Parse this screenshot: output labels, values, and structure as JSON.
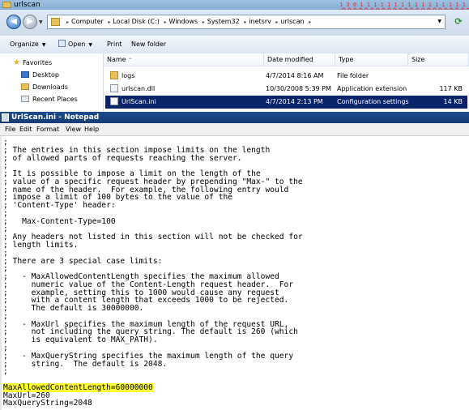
{
  "explorer": {
    "title": "urlscan",
    "annotation_text": "1 3 0 1 1 1 1 1 1 1 1 1 1 1 1 1 1 1 1 1 1",
    "breadcrumbs": [
      "Computer",
      "Local Disk (C:)",
      "Windows",
      "System32",
      "inetsrv",
      "urlscan"
    ],
    "toolbar": {
      "organize": "Organize",
      "open": "Open",
      "print": "Print",
      "new_folder": "New folder"
    },
    "nav": [
      {
        "label": "Favorites",
        "icon": "star-icon"
      },
      {
        "label": "Desktop",
        "icon": "desktop-icon"
      },
      {
        "label": "Downloads",
        "icon": "downloads-icon"
      },
      {
        "label": "Recent Places",
        "icon": "recent-places-icon"
      }
    ],
    "columns": {
      "name": "Name",
      "date": "Date modified",
      "type": "Type",
      "size": "Size"
    },
    "files": [
      {
        "name": "logs",
        "date": "4/7/2014 8:16 AM",
        "type": "File folder",
        "size": "",
        "icon": "folder-icon",
        "selected": false
      },
      {
        "name": "urlscan.dll",
        "date": "10/30/2008 5:39 PM",
        "type": "Application extension",
        "size": "117 KB",
        "icon": "dll-file-icon",
        "selected": false
      },
      {
        "name": "UrlScan.ini",
        "date": "4/7/2014 2:13 PM",
        "type": "Configuration settings",
        "size": "14 KB",
        "icon": "ini-file-icon",
        "selected": true
      }
    ]
  },
  "notepad": {
    "title": "UrlScan.ini - Notepad",
    "menu": [
      "File",
      "Edit",
      "Format",
      "View",
      "Help"
    ],
    "lines": [
      ";",
      "; The entries in this section impose limits on the length",
      "; of allowed parts of requests reaching the server.",
      ";",
      "; It is possible to impose a limit on the length of the",
      "; value of a specific request header by prepending \"Max-\" to the",
      "; name of the header.  For example, the following entry would",
      "; impose a limit of 100 bytes to the value of the",
      "; 'Content-Type' header:",
      ";",
      ";   Max-Content-Type=100",
      ";",
      "; Any headers not listed in this section will not be checked for",
      "; length limits.",
      ";",
      "; There are 3 special case limits:",
      ";",
      ";   - MaxAllowedContentLength specifies the maximum allowed",
      ";     numeric value of the Content-Length request header.  For",
      ";     example, setting this to 1000 would cause any request",
      ";     with a content length that exceeds 1000 to be rejected.",
      ";     The default is 30000000.",
      ";",
      ";   - MaxUrl specifies the maximum length of the request URL,",
      ";     not including the query string. The default is 260 (which",
      ";     is equivalent to MAX_PATH).",
      ";",
      ";   - MaxQueryString specifies the maximum length of the query",
      ";     string.  The default is 2048.",
      ";",
      "",
      "MaxAllowedContentLength=60000000",
      "MaxUrl=260",
      "MaxQueryString=2048"
    ],
    "highlighted_line_index": 31
  }
}
